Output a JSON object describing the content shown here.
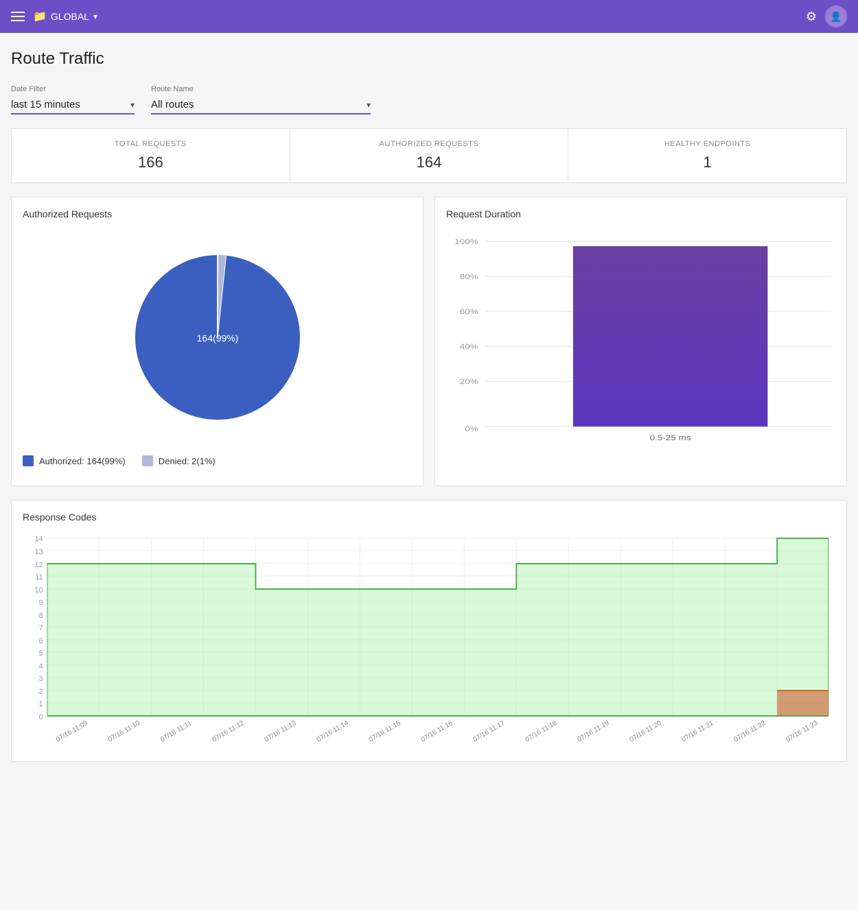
{
  "header": {
    "brand": "GLOBAL",
    "brand_icon": "📁",
    "gear_icon": "⚙",
    "chevron": "▾"
  },
  "page": {
    "title": "Route Traffic"
  },
  "filters": {
    "date_filter_label": "Date Filter",
    "date_filter_value": "last 15 minutes",
    "route_name_label": "Route Name",
    "route_name_value": "All routes"
  },
  "stats": [
    {
      "label": "TOTAL REQUESTS",
      "value": "166"
    },
    {
      "label": "AUTHORIZED REQUESTS",
      "value": "164"
    },
    {
      "label": "HEALTHY ENDPOINTS",
      "value": "1"
    }
  ],
  "authorized_requests": {
    "title": "Authorized Requests",
    "authorized_label": "Authorized: 164(99%)",
    "denied_label": "Denied: 2(1%)",
    "authorized_value": 164,
    "authorized_pct": 99,
    "denied_value": 2,
    "denied_pct": 1,
    "center_label": "164(99%)"
  },
  "request_duration": {
    "title": "Request Duration",
    "bar_label": "0.5-25 ms",
    "y_labels": [
      "100%",
      "80%",
      "60%",
      "40%",
      "20%",
      "0%"
    ],
    "bar_height_pct": 95
  },
  "response_codes": {
    "title": "Response Codes",
    "y_labels": [
      "14",
      "13",
      "12",
      "11",
      "10",
      "9",
      "8",
      "7",
      "6",
      "5",
      "4",
      "3",
      "2",
      "1",
      "0"
    ],
    "x_labels": [
      "07/16 11:09",
      "07/16 11:10",
      "07/16 11:11",
      "07/16 11:12",
      "07/16 11:13",
      "07/16 11:14",
      "07/16 11:15",
      "07/16 11:16",
      "07/16 11:17",
      "07/16 11:18",
      "07/16 11:19",
      "07/16 11:20",
      "07/16 11:21",
      "07/16 11:22",
      "07/16 11:23"
    ]
  }
}
